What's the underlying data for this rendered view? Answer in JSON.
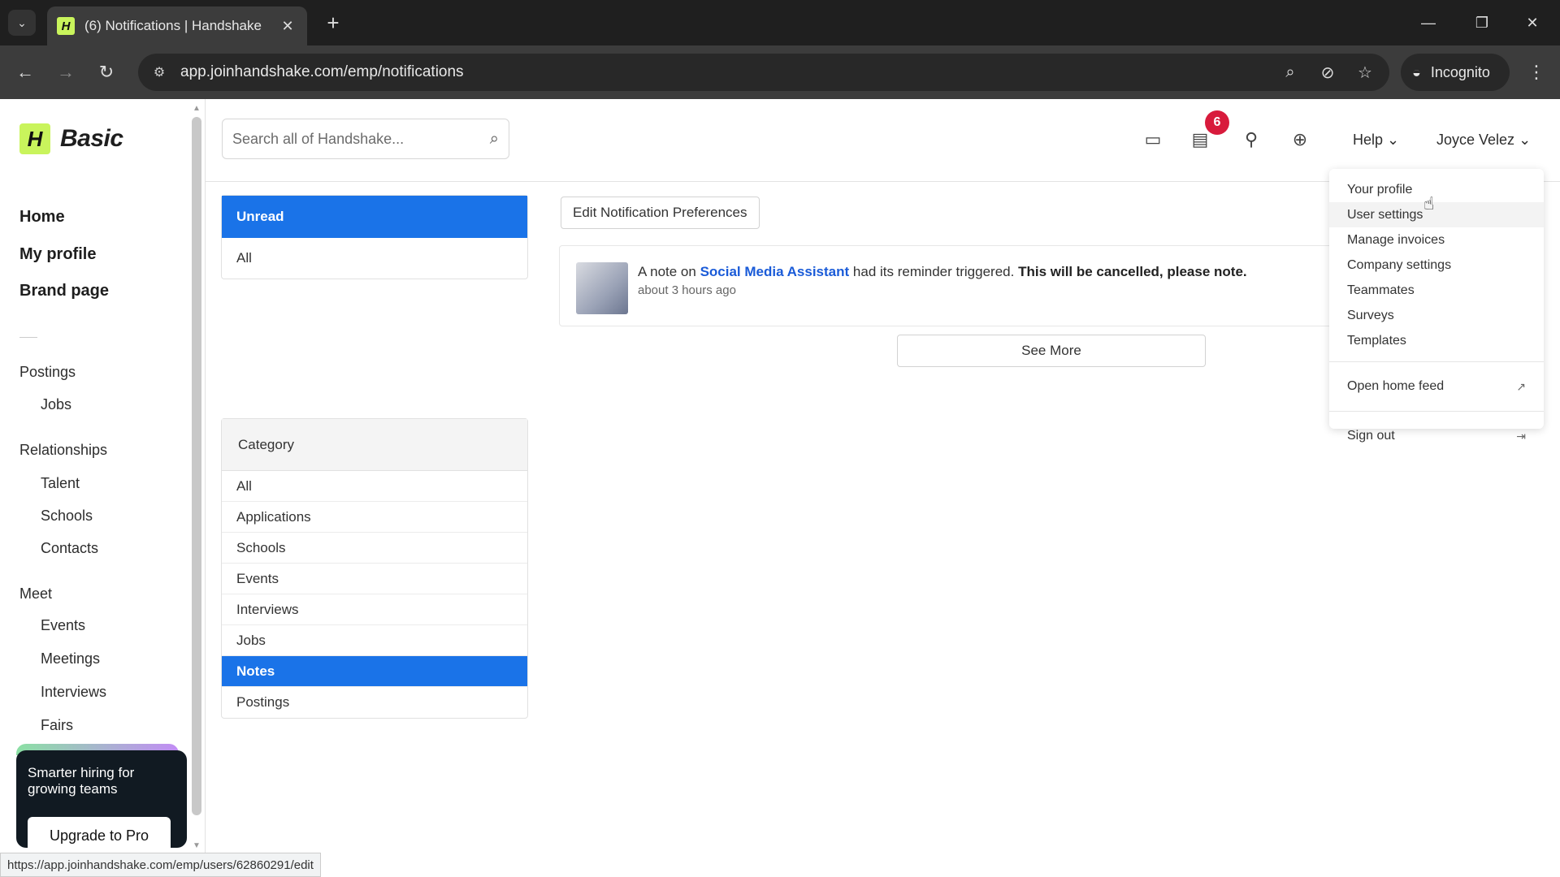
{
  "browser": {
    "tab_title": "(6) Notifications | Handshake",
    "url": "app.joinhandshake.com/emp/notifications",
    "incognito_label": "Incognito",
    "status_url": "https://app.joinhandshake.com/emp/users/62860291/edit"
  },
  "sidebar": {
    "logo_text": "Basic",
    "main_links": [
      "Home",
      "My profile",
      "Brand page"
    ],
    "postings_label": "Postings",
    "postings_items": [
      "Jobs"
    ],
    "relationships_label": "Relationships",
    "relationships_items": [
      "Talent",
      "Schools",
      "Contacts"
    ],
    "meet_label": "Meet",
    "meet_items": [
      "Events",
      "Meetings",
      "Interviews",
      "Fairs"
    ],
    "promo_text": "Smarter hiring for growing teams",
    "promo_button": "Upgrade to Pro"
  },
  "header": {
    "search_placeholder": "Search all of Handshake...",
    "notification_count": "6",
    "help_label": "Help",
    "user_name": "Joyce Velez"
  },
  "filters": {
    "read_state": [
      "Unread",
      "All"
    ],
    "category_label": "Category",
    "categories": [
      "All",
      "Applications",
      "Schools",
      "Events",
      "Interviews",
      "Jobs",
      "Notes",
      "Postings"
    ],
    "active_category": "Notes"
  },
  "main": {
    "edit_pref_label": "Edit Notification Preferences",
    "notification": {
      "prefix": "A note on ",
      "link": "Social Media Assistant",
      "middle": " had its reminder triggered. ",
      "strong": "This will be cancelled, please note.",
      "time": "about 3 hours ago"
    },
    "see_more_label": "See More"
  },
  "dropdown": {
    "items": [
      "Your profile",
      "User settings",
      "Manage invoices",
      "Company settings",
      "Teammates",
      "Surveys",
      "Templates"
    ],
    "open_home_feed": "Open home feed",
    "sign_out": "Sign out"
  },
  "colors": {
    "accent_blue": "#1a73e8",
    "badge_red": "#d81b3c",
    "logo_green": "#c9f45c"
  }
}
